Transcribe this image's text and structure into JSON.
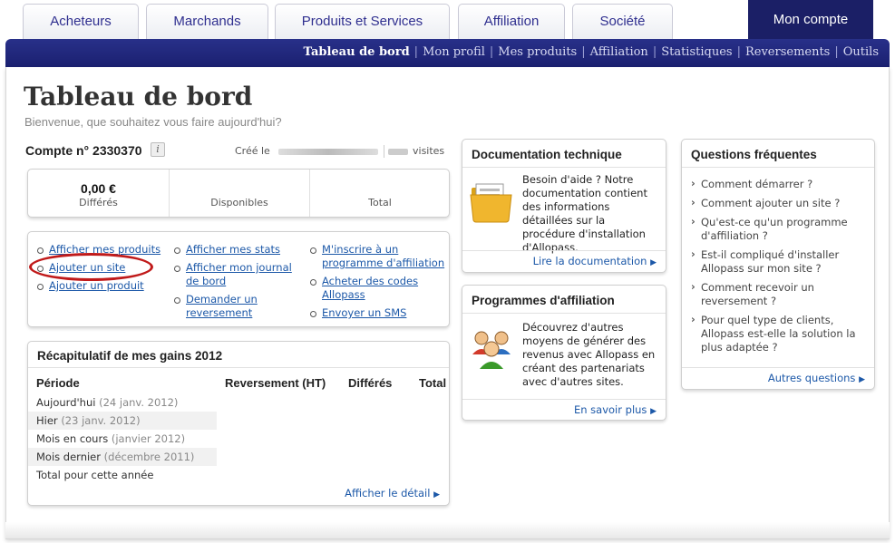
{
  "tabs": [
    "Acheteurs",
    "Marchands",
    "Produits et Services",
    "Affiliation",
    "Société",
    "Mon compte"
  ],
  "subnav": [
    "Tableau de bord",
    "Mon profil",
    "Mes produits",
    "Affiliation",
    "Statistiques",
    "Reversements",
    "Outils"
  ],
  "page": {
    "title": "Tableau de bord",
    "subtitle": "Bienvenue, que souhaitez vous faire aujourd'hui?"
  },
  "account": {
    "number_label": "Compte n° 2330370",
    "info_icon": "i",
    "created_label": "Créé le",
    "visits_label": "visites"
  },
  "balance": {
    "differes_amount": "0,00 €",
    "differes_label": "Différés",
    "disponibles_label": "Disponibles",
    "total_label": "Total"
  },
  "quick_links": {
    "col1": [
      "Afficher mes produits",
      "Ajouter un site",
      "Ajouter un produit"
    ],
    "col2": [
      "Afficher mes stats",
      "Afficher mon journal de bord",
      "Demander un reversement"
    ],
    "col3": [
      "M'inscrire à un programme d'affiliation",
      "Acheter des codes Allopass",
      "Envoyer un SMS"
    ]
  },
  "gains": {
    "title": "Récapitulatif de mes gains 2012",
    "headers": [
      "Période",
      "Reversement (HT)",
      "Différés",
      "Total"
    ],
    "rows": [
      {
        "label": "Aujourd'hui",
        "date": "(24 janv. 2012)"
      },
      {
        "label": "Hier",
        "date": "(23 janv. 2012)"
      },
      {
        "label": "Mois en cours",
        "date": "(janvier 2012)"
      },
      {
        "label": "Mois dernier",
        "date": "(décembre 2011)"
      },
      {
        "label": "Total pour cette année",
        "date": ""
      }
    ],
    "detail_link": "Afficher le détail"
  },
  "doc": {
    "title": "Documentation technique",
    "text": "Besoin d'aide ? Notre documentation contient des informations détaillées sur la procédure d'installation d'Allopass.",
    "link": "Lire la documentation"
  },
  "affiliation": {
    "title": "Programmes d'affiliation",
    "text": "Découvrez d'autres moyens de générer des revenus avec Allopass en créant des partenariats avec d'autres sites.",
    "link": "En savoir plus"
  },
  "faq": {
    "title": "Questions fréquentes",
    "items": [
      "Comment démarrer ?",
      "Comment ajouter un site ?",
      "Qu'est-ce qu'un programme d'affiliation ?",
      "Est-il compliqué d'installer Allopass sur mon site ?",
      "Comment recevoir un reversement ?",
      "Pour quel type de clients, Allopass est-elle la solution la plus adaptée ?"
    ],
    "link": "Autres questions"
  },
  "colors": {
    "navy": "#1b1f66",
    "link": "#1c58a8",
    "highlight_ellipse": "#c01a1a"
  }
}
